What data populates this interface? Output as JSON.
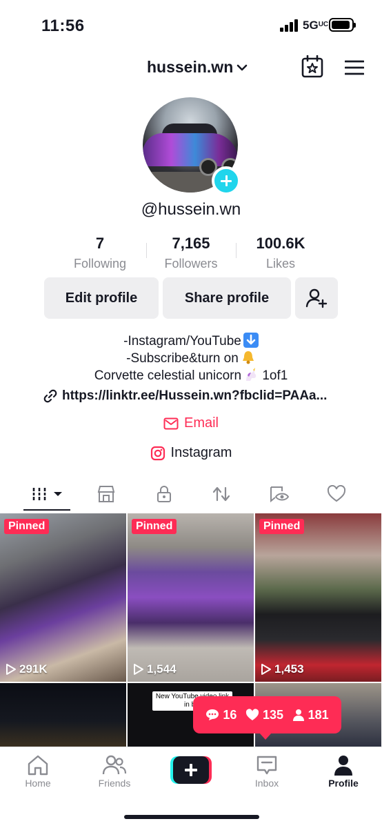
{
  "status_bar": {
    "time": "11:56",
    "network": "5G",
    "network_suffix": "UC"
  },
  "header": {
    "username": "hussein.wn"
  },
  "profile": {
    "handle": "@hussein.wn"
  },
  "stats": [
    {
      "value": "7",
      "label": "Following"
    },
    {
      "value": "7,165",
      "label": "Followers"
    },
    {
      "value": "100.6K",
      "label": "Likes"
    }
  ],
  "buttons": {
    "edit": "Edit profile",
    "share": "Share profile"
  },
  "bio": {
    "line1": "-Instagram/YouTube",
    "line2": "-Subscribe&turn on",
    "line3": "Corvette celestial unicorn",
    "line3_suffix": "1of1",
    "link": "https://linktr.ee/Hussein.wn?fbclid=PAAa...",
    "email": "Email",
    "instagram": "Instagram"
  },
  "videos": [
    {
      "pinned": "Pinned",
      "views": "291K"
    },
    {
      "pinned": "Pinned",
      "views": "1,544"
    },
    {
      "pinned": "Pinned",
      "views": "1,453"
    },
    {
      "overlay_text": ""
    },
    {
      "overlay_text": "New YouTube video link in bio"
    },
    {
      "overlay_text": ""
    }
  ],
  "notification": {
    "comments": "16",
    "likes": "135",
    "followers": "181"
  },
  "nav": {
    "home": "Home",
    "friends": "Friends",
    "inbox": "Inbox",
    "profile": "Profile"
  },
  "colors": {
    "accent": "#fe2c55",
    "cyan": "#20d5ec",
    "text": "#161823",
    "muted": "#8a8b91"
  }
}
